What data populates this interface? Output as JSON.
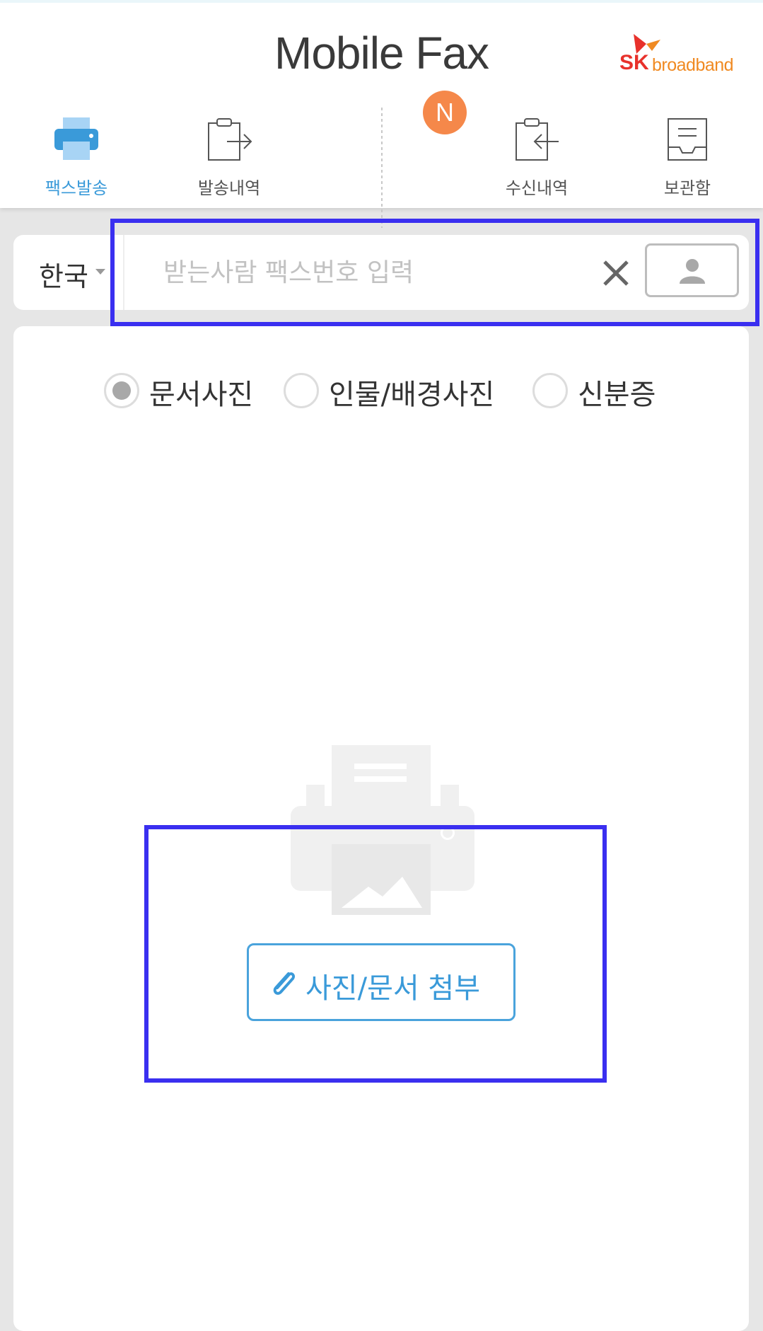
{
  "app": {
    "title": "Mobile Fax",
    "logo_sk": "SK",
    "logo_broadband": "broadband",
    "new_badge": "N"
  },
  "nav": {
    "items": [
      {
        "label": "팩스발송",
        "icon": "printer-icon",
        "active": true
      },
      {
        "label": "발송내역",
        "icon": "outbox-icon",
        "active": false
      },
      {
        "label": "수신내역",
        "icon": "inbox-icon",
        "active": false
      },
      {
        "label": "보관함",
        "icon": "archive-tray-icon",
        "active": false
      }
    ]
  },
  "recipient": {
    "country": "한국",
    "fax_value": "",
    "fax_placeholder": "받는사람 팩스번호 입력",
    "clear_icon": "close-icon",
    "contacts_icon": "person-icon"
  },
  "photo_type": {
    "options": [
      {
        "label": "문서사진",
        "checked": true
      },
      {
        "label": "인물/배경사진",
        "checked": false
      },
      {
        "label": "신분증",
        "checked": false
      }
    ]
  },
  "attach": {
    "label": "사진/문서 첨부",
    "icon": "paperclip-icon",
    "illustration": "fax-machine-icon"
  },
  "colors": {
    "accent": "#3a9ad9",
    "badge": "#f5884a",
    "highlight": "#3a2ff0",
    "logo_red": "#e8312b",
    "logo_orange": "#f08a22"
  }
}
